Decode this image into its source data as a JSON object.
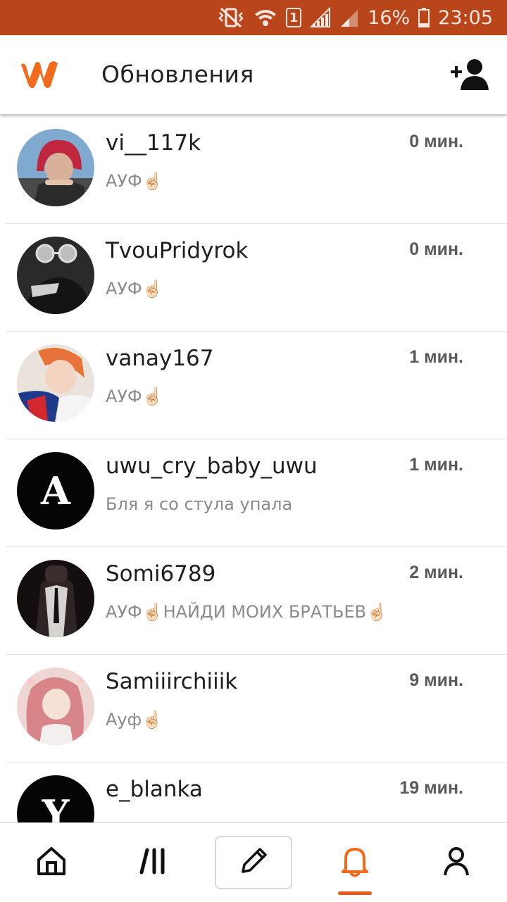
{
  "status_bar": {
    "battery": "16%",
    "time": "23:05",
    "sim_label": "1",
    "icons": [
      "mute-vibrate-icon",
      "wifi-icon",
      "sim-1-icon",
      "signal-icon",
      "signal-2-icon",
      "battery-icon"
    ]
  },
  "header": {
    "title": "Обновления",
    "logo_icon": "wattpad-logo-icon",
    "action_icon": "add-user-icon"
  },
  "colors": {
    "status_bar": "#b8461a",
    "accent": "#f26a1b",
    "text": "#1e1e1e",
    "muted": "#8a8a8a"
  },
  "updates": [
    {
      "username": "vi__117k",
      "time": "0 мин.",
      "message": "АУФ☝🏻"
    },
    {
      "username": "TvouPridyrok",
      "time": "0 мин.",
      "message": "АУФ☝🏻"
    },
    {
      "username": "vanay167",
      "time": "1 мин.",
      "message": "АУФ☝🏻"
    },
    {
      "username": "uwu_cry_baby_uwu",
      "time": "1 мин.",
      "message": "Бля я со стула упала",
      "avatar_letter": "A"
    },
    {
      "username": "Somi6789",
      "time": "2 мин.",
      "message": "АУФ☝🏻НАЙДИ МОИХ БРАТЬЕВ☝🏻"
    },
    {
      "username": "Samiiirchiiik",
      "time": "9 мин.",
      "message": "Ауф☝🏻"
    },
    {
      "username": "e_blanka",
      "time": "19 мин.",
      "message": "",
      "avatar_letter": "Y"
    }
  ],
  "bottom_nav": [
    {
      "icon": "home-icon"
    },
    {
      "icon": "library-icon"
    },
    {
      "icon": "pencil-icon"
    },
    {
      "icon": "bell-icon",
      "active": true
    },
    {
      "icon": "profile-icon"
    }
  ]
}
